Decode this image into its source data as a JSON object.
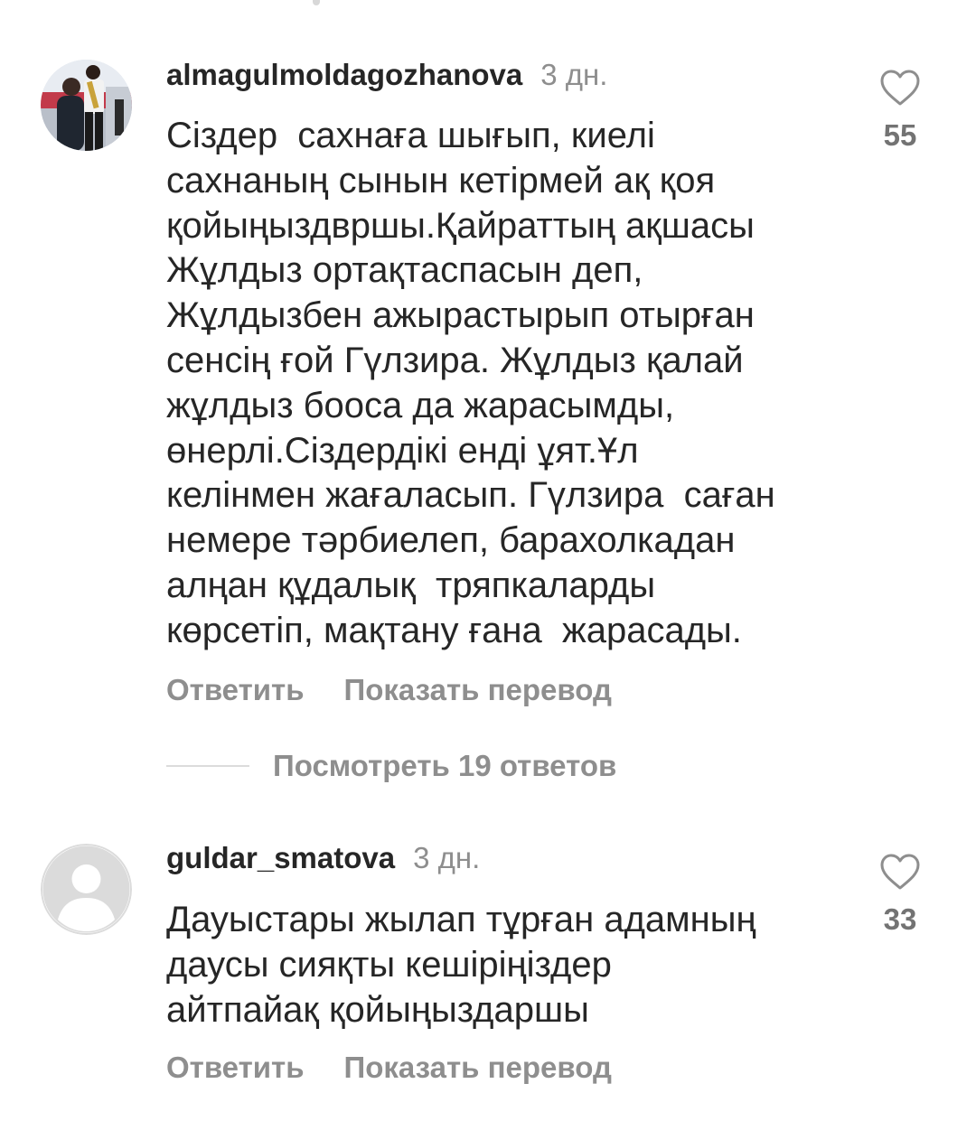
{
  "comments": [
    {
      "username": "almagulmoldagozhanova",
      "time": "3 дн.",
      "lines": [
        "Сіздер  сахнаға шығып, киелі",
        "сахнаның сынын кетірмей ақ қоя",
        "қойыңыздвршы.Қайраттың ақшасы",
        "Жұлдыз ортақтаспасын деп,",
        "Жұлдызбен ажырастырып отырған",
        "сенсің ғой Гүлзира. Жұлдыз қалай",
        "жұлдыз бооса да жарасымды,",
        "өнерлі.Сіздердікі енді ұят.Ұл",
        "келінмен жағаласып. Гүлзира  саған",
        "немере тәрбиелеп, барахолкадан",
        "алңан құдалық  тряпкаларды",
        "көрсетіп, мақтану ғана  жарасады."
      ],
      "reply_label": "Ответить",
      "translate_label": "Показать перевод",
      "like_icon": "heart-outline-icon",
      "likes": "55",
      "view_replies_label": "Посмотреть 19 ответов"
    },
    {
      "username": "guldar_smatova",
      "time": "3 дн.",
      "lines": [
        "Дауыстары жылап тұрған адамның",
        "даусы сияқты кешіріңіздер",
        "айтпайақ қойыңыздаршы"
      ],
      "reply_label": "Ответить",
      "translate_label": "Показать перевод",
      "like_icon": "heart-outline-icon",
      "likes": "33"
    }
  ],
  "colors": {
    "text_primary": "#262626",
    "text_secondary": "#8e8e8e",
    "divider": "#dbdbdb",
    "default_avatar_bg": "#dbdbdb"
  }
}
